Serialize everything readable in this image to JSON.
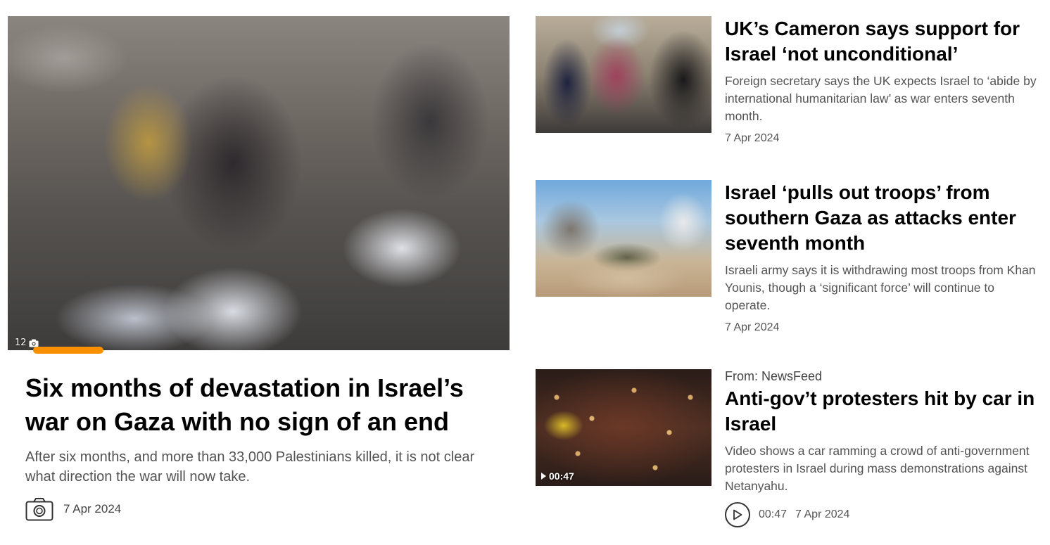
{
  "featured": {
    "photo_count": "12",
    "gallery_progress_percent": 14,
    "title": "Six months of devastation in Israel’s war on Gaza with no sign of an end",
    "summary": "After six months, and more than 33,000 Palestinians killed, it is not clear what direction the war will now take.",
    "date": "7 Apr 2024",
    "media_icon": "camera-icon"
  },
  "articles": [
    {
      "title": "UK’s Cameron says support for Israel ‘not unconditional’",
      "summary": "Foreign secretary says the UK expects Israel to ‘abide by international humanitarian law’ as war enters seventh month.",
      "date": "7 Apr 2024"
    },
    {
      "title": "Israel ‘pulls out troops’ from southern Gaza as attacks enter seventh month",
      "summary": "Israeli army says it is withdrawing most troops from Khan Younis, though a ‘significant force’ will continue to operate.",
      "date": "7 Apr 2024"
    },
    {
      "source": "From: NewsFeed",
      "title": "Anti-gov’t protesters hit by car in Israel",
      "summary": "Video shows a car ramming a crowd of anti-gov­ernment protesters in Israel during mass demon­strations against Netanyahu.",
      "duration_badge": "00:47",
      "duration": "00:47",
      "date": "7 Apr 2024",
      "media_icon": "play-icon"
    }
  ],
  "colors": {
    "accent": "#fa9000",
    "summary_text": "#535353",
    "title_text": "#000000"
  }
}
